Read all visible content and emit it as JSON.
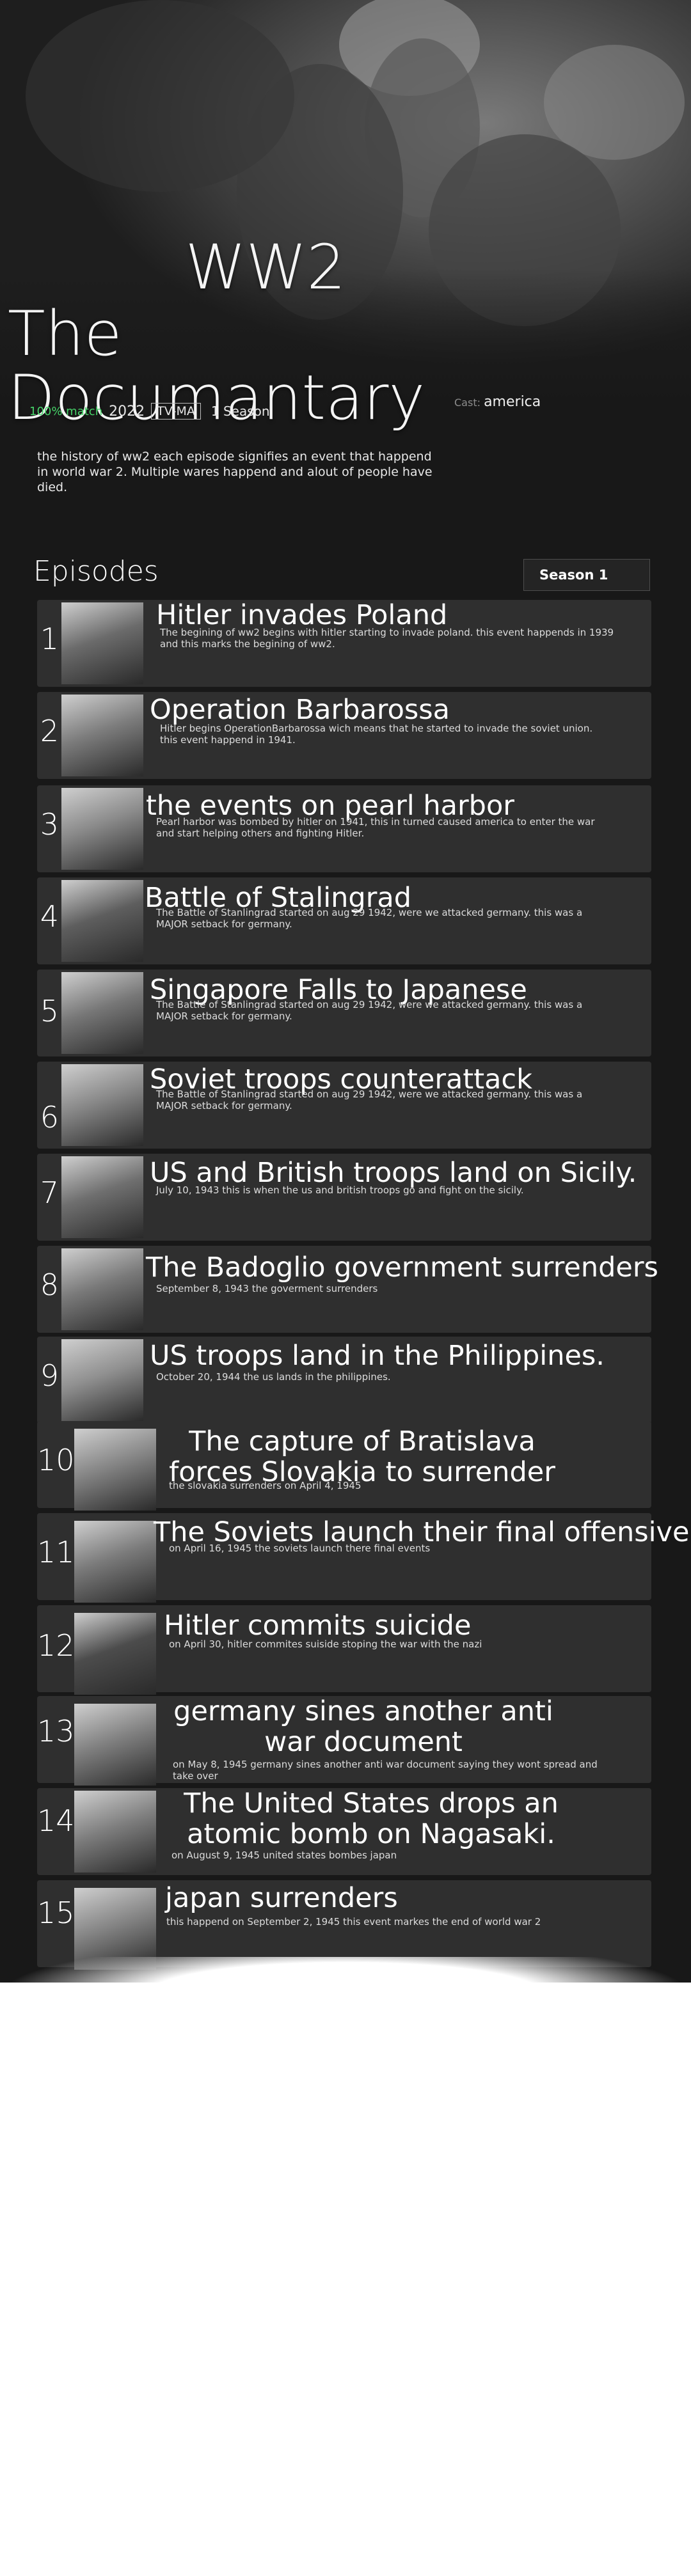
{
  "show": {
    "title_line1": "WW2",
    "title_line2": "The Documantary",
    "match": "100% match",
    "year": "2022",
    "rating": "TV-MA",
    "seasons": "1 Season",
    "cast_label": "Cast:",
    "cast_value": "america",
    "description": "the history of ww2 each episode signifies an event that happend in world war 2. Multiple wares happend and alout of people have died."
  },
  "episodes_section": {
    "heading": "Episodes",
    "season_selected": "Season 1"
  },
  "episodes": [
    {
      "num": "1",
      "title": "Hitler invades Poland",
      "text": "The begining of ww2 begins with hitler starting to invade poland. this event happends in 1939 and this marks the begining of ww2."
    },
    {
      "num": "2",
      "title": "Operation Barbarossa",
      "text": "Hitler begins OperationBarbarossa wich means that he started to invade the soviet union. this event happend in 1941."
    },
    {
      "num": "3",
      "title": "the events on pearl harbor",
      "text": "Pearl harbor was bombed by hitler on 1941, this in turned caused america to enter the war and start helping others and fighting Hitler."
    },
    {
      "num": "4",
      "title": "Battle of Stalingrad",
      "text": "The Battle of Stanlingrad started on aug 29 1942, were we attacked germany. this was a MAJOR setback for germany."
    },
    {
      "num": "5",
      "title": "Singapore Falls to Japanese",
      "text": "The Battle of Stanlingrad started on aug 29 1942, were we attacked germany. this was a MAJOR setback for germany."
    },
    {
      "num": "6",
      "title": "Soviet troops counterattack",
      "text": "The Battle of Stanlingrad started on aug 29 1942, were we attacked germany. this was a MAJOR setback for germany."
    },
    {
      "num": "7",
      "title": "US and British troops land on Sicily.",
      "text": "July 10, 1943 this is when the us and british troops go and fight on the sicily."
    },
    {
      "num": "8",
      "title": "The Badoglio government surrenders",
      "text": "September 8, 1943 the goverment surrenders"
    },
    {
      "num": "9",
      "title": "US troops land in the Philippines.",
      "text": "October 20, 1944  the us lands in the philippines."
    },
    {
      "num": "10",
      "title": "The capture of Bratislava forces Slovakia to surrender",
      "text": "the slovakia surrenders on April 4, 1945"
    },
    {
      "num": "11",
      "title": "The Soviets launch their final offensive",
      "text": "on April 16, 1945 the soviets launch there final events"
    },
    {
      "num": "12",
      "title": "Hitler commits suicide",
      "text": "on April 30, hitler commites suiside stoping the war with the nazi"
    },
    {
      "num": "13",
      "title": "germany sines another anti war document",
      "text": "on May 8, 1945 germany sines another anti war document saying they wont spread and take over"
    },
    {
      "num": "14",
      "title": "The United States drops an atomic bomb on Nagasaki.",
      "text": "on August 9, 1945 united states bombes japan"
    },
    {
      "num": "15",
      "title": "japan surrenders",
      "text": "this happend on September 2, 1945 this event markes the end of world war 2"
    }
  ],
  "colors": {
    "background": "#181818",
    "card": "#2f2f2f",
    "match": "#46d369"
  }
}
